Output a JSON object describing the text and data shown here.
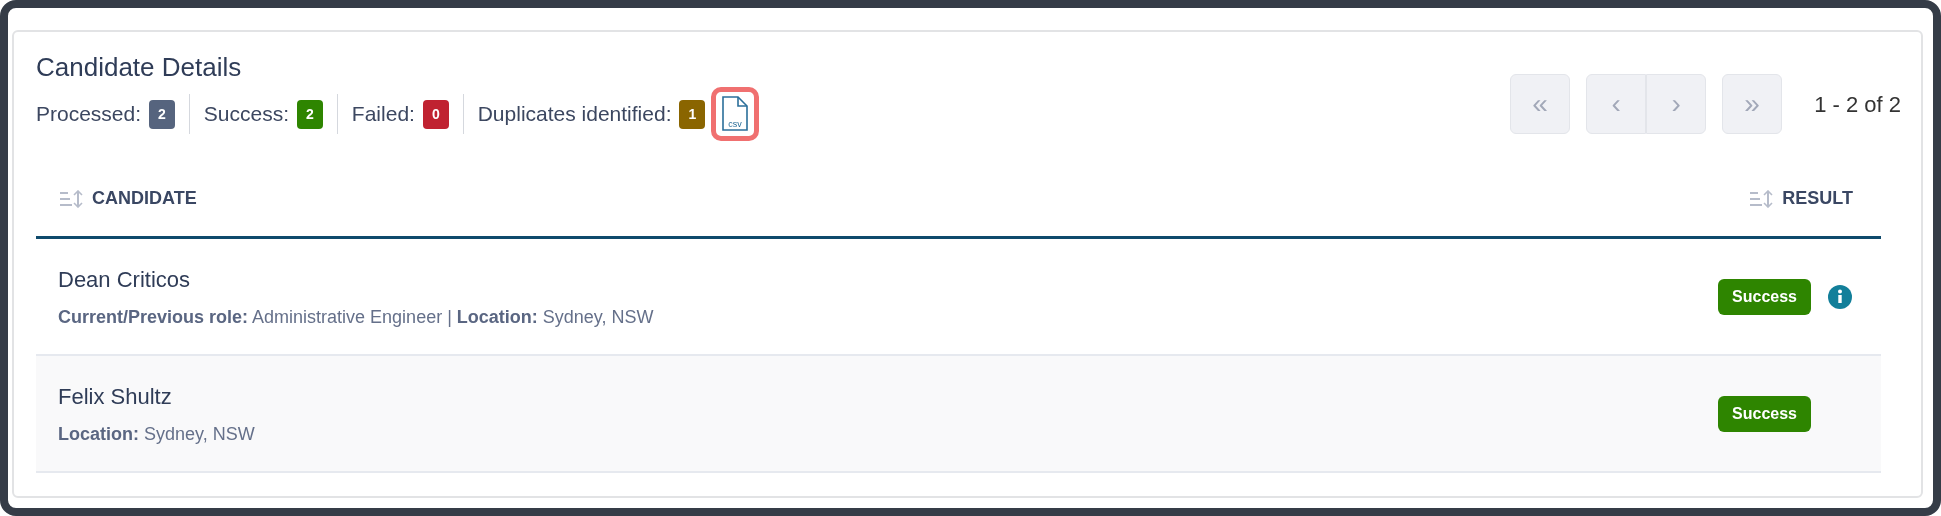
{
  "title": "Candidate Details",
  "stats": [
    {
      "label": "Processed:",
      "count": "2",
      "color": "#56647e"
    },
    {
      "label": "Success:",
      "count": "2",
      "color": "#2e8500"
    },
    {
      "label": "Failed:",
      "count": "0",
      "color": "#c02231"
    },
    {
      "label": "Duplicates identified:",
      "count": "1",
      "color": "#8a6500"
    }
  ],
  "export": {
    "label": "csv",
    "highlighted": true
  },
  "pager": {
    "groups": [
      [
        {
          "glyph": "«",
          "disabled": true
        }
      ],
      [
        {
          "glyph": "‹",
          "disabled": true
        },
        {
          "glyph": "›",
          "disabled": true
        }
      ],
      [
        {
          "glyph": "»",
          "disabled": true
        }
      ]
    ],
    "range": "1 - 2 of 2"
  },
  "table": {
    "columns": [
      "CANDIDATE",
      "RESULT"
    ],
    "rows": [
      {
        "name": "Dean Criticos",
        "details": [
          {
            "label": "Current/Previous role:",
            "value": "Administrative Engineer |"
          },
          {
            "label": "Location:",
            "value": "Sydney, NSW"
          }
        ],
        "result": "Success",
        "info": true
      },
      {
        "name": "Felix Shultz",
        "details": [
          {
            "label": "Location:",
            "value": "Sydney, NSW"
          }
        ],
        "result": "Success",
        "info": false
      }
    ]
  }
}
